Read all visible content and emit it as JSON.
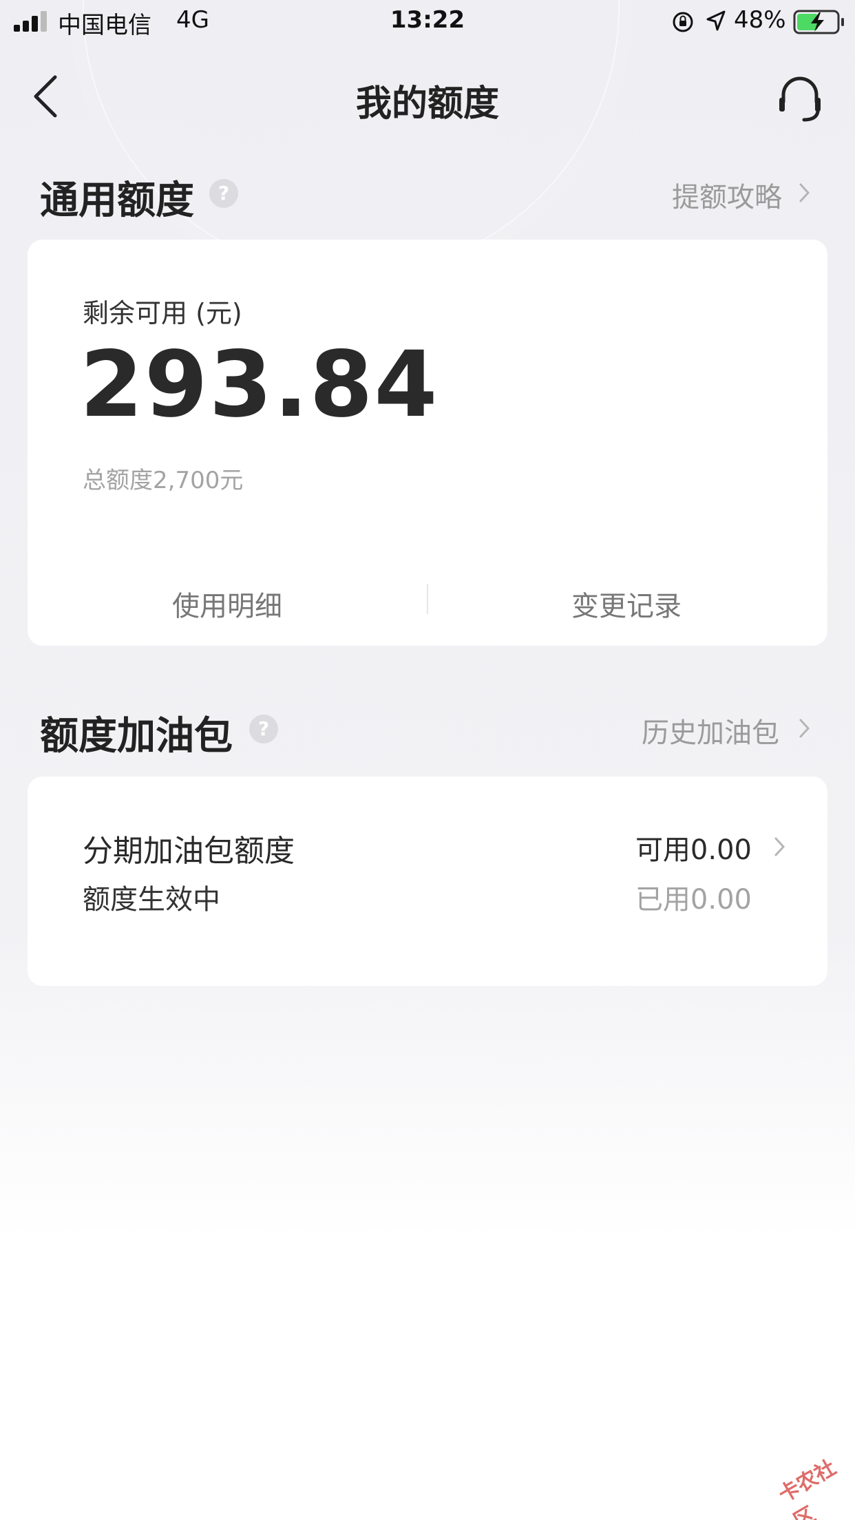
{
  "status_bar": {
    "carrier": "中国电信",
    "network": "4G",
    "time": "13:22",
    "battery": "48%",
    "icons": [
      "signal-icon",
      "orientation-lock-icon",
      "location-icon",
      "battery-charging-icon"
    ]
  },
  "nav": {
    "title": "我的额度",
    "icons": [
      "back-arrow-icon",
      "customer-service-icon"
    ]
  },
  "general_quota": {
    "title": "通用额度",
    "help_icon": "?",
    "link": "提额攻略",
    "remaining_label": "剩余可用 (元)",
    "remaining_amount": "293.84",
    "total_label": "总额度2,700元",
    "actions": [
      "使用明细",
      "变更记录"
    ]
  },
  "boost_pack": {
    "title": "额度加油包",
    "help_icon": "?",
    "link": "历史加油包",
    "item": {
      "name": "分期加油包额度",
      "status": "额度生效中",
      "available": "可用0.00",
      "used": "已用0.00"
    }
  },
  "watermark": "卡农社区",
  "colors": {
    "background": "#efeff3",
    "card": "#ffffff",
    "text_primary": "#2a2a2a",
    "text_secondary": "#9a9a9a",
    "battery": "#4cd964"
  }
}
